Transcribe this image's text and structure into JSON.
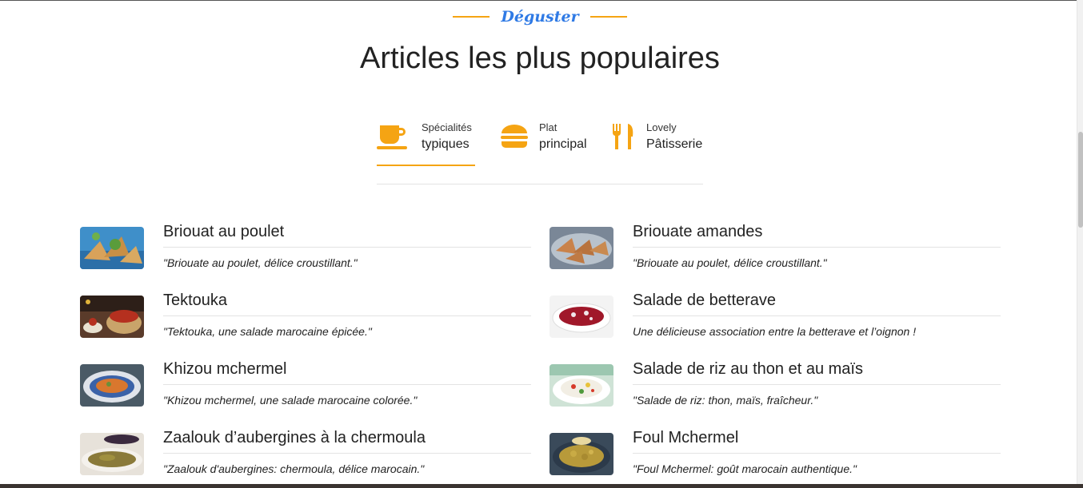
{
  "section": {
    "eyebrow": "Déguster",
    "title": "Articles les plus populaires"
  },
  "tabs": [
    {
      "small": "Spécialités",
      "big": "typiques",
      "icon": "coffee-cup-icon",
      "active": true
    },
    {
      "small": "Plat",
      "big": "principal",
      "icon": "burger-icon",
      "active": false
    },
    {
      "small": "Lovely",
      "big": "Pâtisserie",
      "icon": "utensils-icon",
      "active": false
    }
  ],
  "colors": {
    "accent": "#f5a413",
    "eyebrow": "#2f7ae5"
  },
  "items": [
    {
      "title": "Briouat au poulet",
      "desc": "\"Briouate au poulet, délice croustillant.\""
    },
    {
      "title": "Briouate amandes",
      "desc": "\"Briouate au poulet, délice croustillant.\""
    },
    {
      "title": "Tektouka",
      "desc": "\"Tektouka, une salade marocaine épicée.\""
    },
    {
      "title": "Salade de betterave",
      "desc": "Une délicieuse association entre la betterave et l’oignon !"
    },
    {
      "title": "Khizou mchermel",
      "desc": "\"Khizou mchermel, une salade marocaine colorée.\""
    },
    {
      "title": "Salade de riz au thon et au maïs",
      "desc": "\"Salade de riz: thon, maïs, fraîcheur.\""
    },
    {
      "title": "Zaalouk d’aubergines à la chermoula",
      "desc": "\"Zaalouk d'aubergines: chermoula, délice marocain.\""
    },
    {
      "title": "Foul Mchermel",
      "desc": "\"Foul Mchermel: goût marocain authentique.\""
    }
  ]
}
